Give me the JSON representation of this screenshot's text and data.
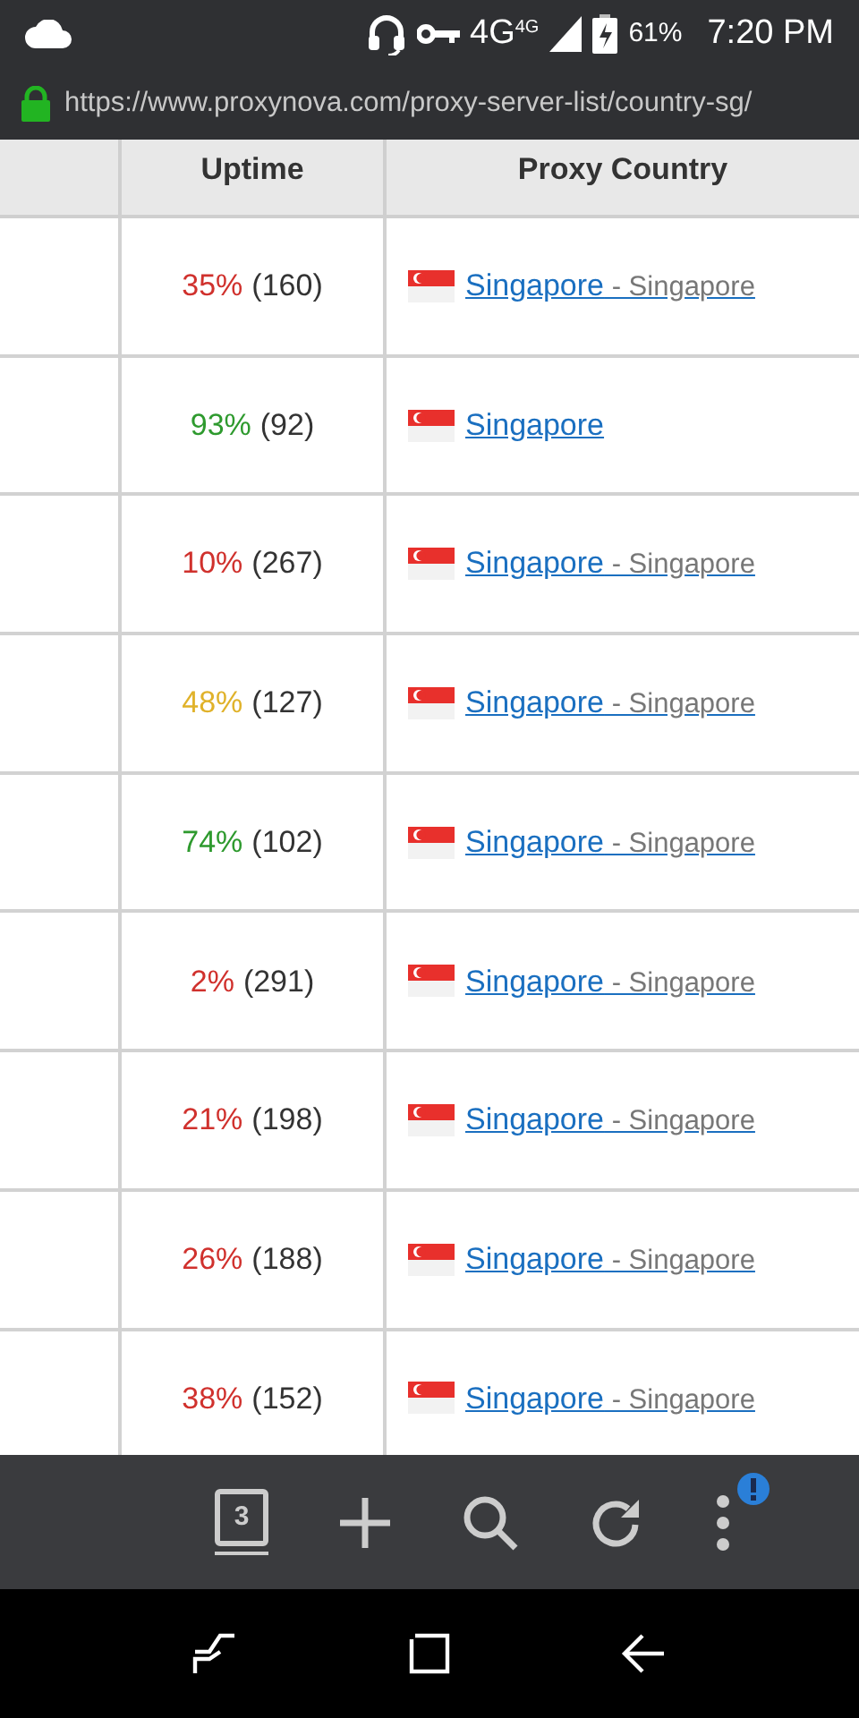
{
  "status_bar": {
    "network": "4G",
    "network_small": "4G",
    "battery": "61%",
    "time": "7:20 PM"
  },
  "address_bar": {
    "url": "https://www.proxynova.com/proxy-server-list/country-sg/",
    "secure": true
  },
  "table": {
    "columns": [
      "Uptime",
      "Proxy Country"
    ],
    "rows": [
      {
        "uptime": "35%",
        "color": "#d0312d",
        "checks": "(160)",
        "country": "Singapore",
        "city": "- Singapore"
      },
      {
        "uptime": "93%",
        "color": "#2e9a2e",
        "checks": "(92)",
        "country": "Singapore"
      },
      {
        "uptime": "10%",
        "color": "#d0312d",
        "checks": "(267)",
        "country": "Singapore",
        "city": "- Singapore"
      },
      {
        "uptime": "48%",
        "color": "#e0b22a",
        "checks": "(127)",
        "country": "Singapore",
        "city": "- Singapore"
      },
      {
        "uptime": "74%",
        "color": "#2e9a2e",
        "checks": "(102)",
        "country": "Singapore",
        "city": "- Singapore"
      },
      {
        "uptime": "2%",
        "color": "#d0312d",
        "checks": "(291)",
        "country": "Singapore",
        "city": "- Singapore"
      },
      {
        "uptime": "21%",
        "color": "#d0312d",
        "checks": "(198)",
        "country": "Singapore",
        "city": "- Singapore"
      },
      {
        "uptime": "26%",
        "color": "#d0312d",
        "checks": "(188)",
        "country": "Singapore",
        "city": "- Singapore"
      },
      {
        "uptime": "38%",
        "color": "#d0312d",
        "checks": "(152)",
        "country": "Singapore",
        "city": "- Singapore"
      }
    ]
  },
  "toolbar": {
    "tab_count": "3",
    "menu_alert": true
  }
}
